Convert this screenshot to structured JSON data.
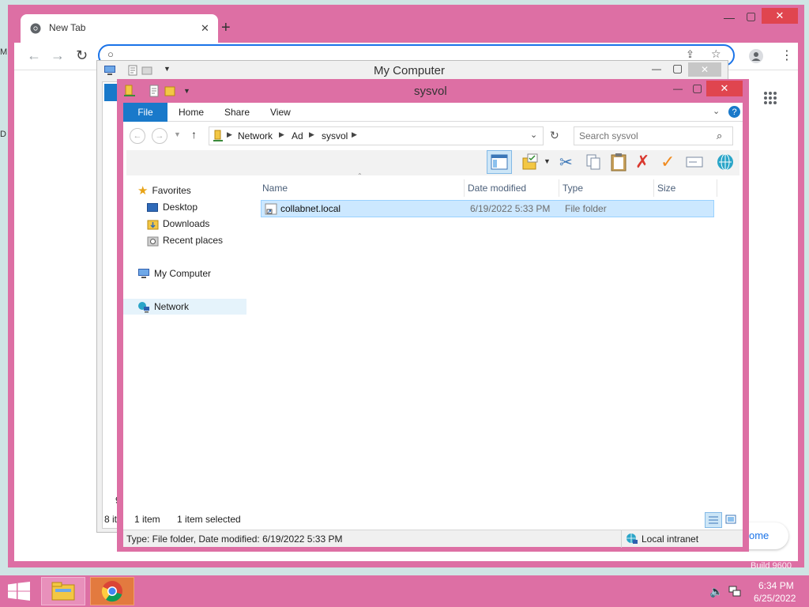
{
  "desktop": {
    "left_glyph_1": "M",
    "left_glyph_2": "D",
    "right_frag_1": "ome",
    "right_frag_2": "Build 9600"
  },
  "chrome": {
    "tab_title": "New Tab"
  },
  "mycomputer": {
    "title": "My Computer",
    "left_frag_1": "9",
    "left_frag_2": "8 it"
  },
  "sysvol": {
    "title": "sysvol",
    "ribbon": {
      "file": "File",
      "home": "Home",
      "share": "Share",
      "view": "View"
    },
    "address": {
      "crumbs": [
        "Network",
        "Ad",
        "sysvol"
      ]
    },
    "search": {
      "placeholder": "Search sysvol"
    },
    "nav": {
      "favorites": "Favorites",
      "desktop": "Desktop",
      "downloads": "Downloads",
      "recent": "Recent places",
      "mycomputer": "My Computer",
      "network": "Network"
    },
    "columns": {
      "name": "Name",
      "date": "Date modified",
      "type": "Type",
      "size": "Size"
    },
    "rows": [
      {
        "name": "collabnet.local",
        "date": "6/19/2022 5:33 PM",
        "type": "File folder",
        "size": ""
      }
    ],
    "status": {
      "count": "1 item",
      "selected": "1 item selected"
    },
    "details": {
      "info": "Type: File folder, Date modified: 6/19/2022 5:33 PM",
      "zone": "Local intranet"
    }
  },
  "taskbar": {
    "time": "6:34 PM",
    "date": "6/25/2022"
  },
  "colors": {
    "window_frame": "#dd6fa4",
    "accent": "#1979ca",
    "selection": "#cce8ff",
    "close_red": "#e0454f"
  }
}
